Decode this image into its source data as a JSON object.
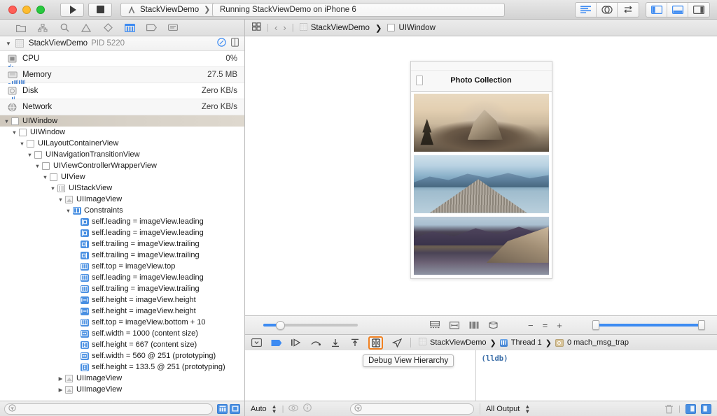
{
  "titlebar": {
    "run_label": "Run",
    "stop_label": "Stop",
    "scheme_project": "StackViewDemo",
    "scheme_device": "iPhone 6",
    "status_text": "Running StackViewDemo on iPhone 6",
    "right_buttons": [
      "standard-editor",
      "assistant-editor",
      "version-editor"
    ],
    "panel_buttons": [
      "toggle-navigator",
      "toggle-debug-area",
      "toggle-utilities"
    ]
  },
  "navigator": {
    "toolbar_icons": [
      "project-navigator",
      "symbol-navigator",
      "find-navigator",
      "issue-navigator",
      "test-navigator",
      "debug-navigator",
      "breakpoint-navigator",
      "report-navigator"
    ],
    "active_icon": "debug-navigator",
    "process": {
      "name": "StackViewDemo",
      "pid": "PID 5220"
    },
    "gauges": [
      {
        "name": "CPU",
        "value": "0%",
        "icon": "cpu-icon"
      },
      {
        "name": "Memory",
        "value": "27.5 MB",
        "icon": "memory-icon"
      },
      {
        "name": "Disk",
        "value": "Zero KB/s",
        "icon": "disk-icon"
      },
      {
        "name": "Network",
        "value": "Zero KB/s",
        "icon": "network-icon"
      }
    ],
    "tree": [
      {
        "label": "UIWindow",
        "indent": 0,
        "disclosure": "open",
        "icon": "view-icon",
        "selected": true
      },
      {
        "label": "UIWindow",
        "indent": 1,
        "disclosure": "open",
        "icon": "view-icon",
        "selected": false
      },
      {
        "label": "UILayoutContainerView",
        "indent": 2,
        "disclosure": "open",
        "icon": "view-icon",
        "selected": false
      },
      {
        "label": "UINavigationTransitionView",
        "indent": 3,
        "disclosure": "open",
        "icon": "view-icon",
        "selected": false
      },
      {
        "label": "UIViewControllerWrapperView",
        "indent": 4,
        "disclosure": "open",
        "icon": "view-icon",
        "selected": false
      },
      {
        "label": "UIView",
        "indent": 5,
        "disclosure": "open",
        "icon": "view-icon",
        "selected": false
      },
      {
        "label": "UIStackView",
        "indent": 6,
        "disclosure": "open",
        "icon": "stackview-icon",
        "selected": false
      },
      {
        "label": "UIImageView",
        "indent": 7,
        "disclosure": "open",
        "icon": "imageview-icon",
        "selected": false
      },
      {
        "label": "Constraints",
        "indent": 8,
        "disclosure": "open",
        "icon": "constraints-icon",
        "selected": false
      },
      {
        "label": "self.leading = imageView.leading",
        "indent": 9,
        "disclosure": "none",
        "icon": "constraint-leading-icon",
        "selected": false
      },
      {
        "label": "self.leading = imageView.leading",
        "indent": 9,
        "disclosure": "none",
        "icon": "constraint-leading-icon",
        "selected": false
      },
      {
        "label": "self.trailing = imageView.trailing",
        "indent": 9,
        "disclosure": "none",
        "icon": "constraint-trailing-icon",
        "selected": false
      },
      {
        "label": "self.trailing = imageView.trailing",
        "indent": 9,
        "disclosure": "none",
        "icon": "constraint-trailing-icon",
        "selected": false
      },
      {
        "label": "self.top = imageView.top",
        "indent": 9,
        "disclosure": "none",
        "icon": "constraint-horizontal-icon",
        "selected": false
      },
      {
        "label": "self.leading = imageView.leading",
        "indent": 9,
        "disclosure": "none",
        "icon": "constraint-horizontal-icon",
        "selected": false
      },
      {
        "label": "self.trailing = imageView.trailing",
        "indent": 9,
        "disclosure": "none",
        "icon": "constraint-horizontal-icon",
        "selected": false
      },
      {
        "label": "self.height = imageView.height",
        "indent": 9,
        "disclosure": "none",
        "icon": "constraint-vertical-icon",
        "selected": false
      },
      {
        "label": "self.height = imageView.height",
        "indent": 9,
        "disclosure": "none",
        "icon": "constraint-vertical-icon",
        "selected": false
      },
      {
        "label": "self.top = imageView.bottom + 10",
        "indent": 9,
        "disclosure": "none",
        "icon": "constraint-horizontal-icon",
        "selected": false
      },
      {
        "label": "self.width = 1000 (content size)",
        "indent": 9,
        "disclosure": "none",
        "icon": "constraint-width-icon",
        "selected": false
      },
      {
        "label": "self.height = 667 (content size)",
        "indent": 9,
        "disclosure": "none",
        "icon": "constraint-height-icon",
        "selected": false
      },
      {
        "label": "self.width = 560 @ 251 (prototyping)",
        "indent": 9,
        "disclosure": "none",
        "icon": "constraint-width-icon",
        "selected": false
      },
      {
        "label": "self.height = 133.5 @ 251 (prototyping)",
        "indent": 9,
        "disclosure": "none",
        "icon": "constraint-height-icon",
        "selected": false
      },
      {
        "label": "UIImageView",
        "indent": 7,
        "disclosure": "closed",
        "icon": "imageview-icon",
        "selected": false
      },
      {
        "label": "UIImageView",
        "indent": 7,
        "disclosure": "closed",
        "icon": "imageview-icon",
        "selected": false
      }
    ]
  },
  "jumpbar": {
    "related_items_icon": "related-items-icon",
    "back_label": "‹",
    "forward_label": "›",
    "crumbs": [
      "StackViewDemo",
      "UIWindow"
    ]
  },
  "canvas": {
    "device_title": "Photo Collection",
    "photos": [
      "mountain-sunset-photo",
      "lake-pier-photo",
      "mountain-reflection-photo"
    ],
    "left_slider_value": 18,
    "right_slider_value": 100,
    "view_mode_icons": [
      "show-clipped-content-icon",
      "show-constraints-icon",
      "adjust-view-spacing-icon",
      "view-3d-icon"
    ],
    "zoom_out_label": "−",
    "zoom_reset_label": "=",
    "zoom_in_label": "+"
  },
  "debugbar": {
    "icons": [
      "hide-debug-area-icon",
      "breakpoints-icon",
      "continue-icon",
      "step-over-icon",
      "step-into-icon",
      "step-out-icon",
      "debug-view-hierarchy-icon",
      "simulate-location-icon"
    ],
    "highlighted_icon": "debug-view-hierarchy-icon",
    "tooltip": "Debug View Hierarchy",
    "crumbs": [
      "StackViewDemo",
      "Thread 1",
      "0 mach_msg_trap"
    ]
  },
  "console": {
    "prompt": "(lldb)"
  },
  "bottombar": {
    "scope_label": "Auto",
    "filter_placeholder": "",
    "output_label": "All Output",
    "trash_icon": "trash-icon"
  },
  "colors": {
    "accent_blue": "#3d8bf2",
    "highlight_orange": "#f08020",
    "selection_tan": "#d6d0c5"
  }
}
